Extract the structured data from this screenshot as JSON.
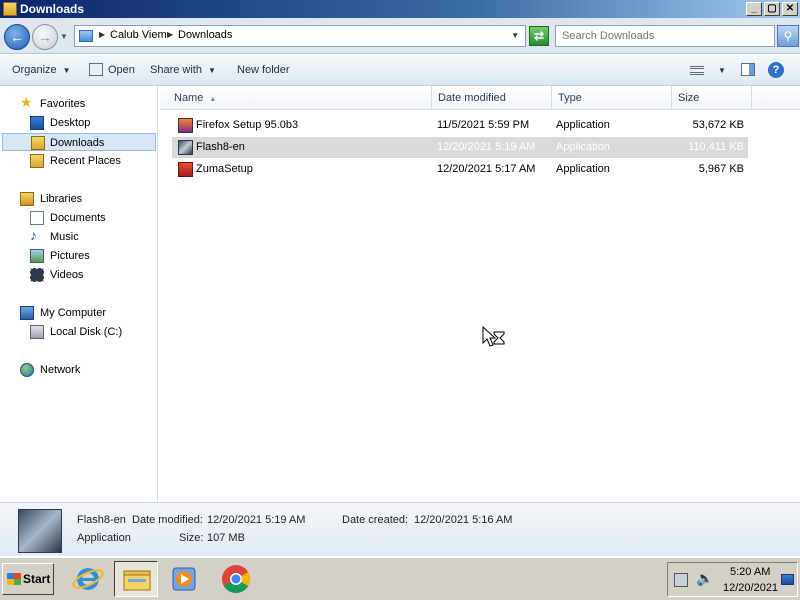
{
  "window": {
    "title": "Downloads",
    "min": "_",
    "max": "▢",
    "close": "✕"
  },
  "address": {
    "crumbs": [
      "Calub Viem",
      "Downloads"
    ],
    "search_placeholder": "Search Downloads"
  },
  "toolbar": {
    "organize": "Organize",
    "open": "Open",
    "share_with": "Share with",
    "new_folder": "New folder"
  },
  "nav": {
    "favorites": "Favorites",
    "desktop": "Desktop",
    "downloads": "Downloads",
    "recent_places": "Recent Places",
    "libraries": "Libraries",
    "documents": "Documents",
    "music": "Music",
    "pictures": "Pictures",
    "videos": "Videos",
    "my_computer": "My Computer",
    "local_disk": "Local Disk (C:)",
    "network": "Network"
  },
  "columns": {
    "name": "Name",
    "date_modified": "Date modified",
    "type": "Type",
    "size": "Size"
  },
  "files": [
    {
      "name": "Firefox Setup 95.0b3",
      "date": "11/5/2021 5:59 PM",
      "type": "Application",
      "size": "53,672 KB",
      "icon": "firefox-installer-icon"
    },
    {
      "name": "Flash8-en",
      "date": "12/20/2021 5:19 AM",
      "type": "Application",
      "size": "110,411 KB",
      "icon": "flash-installer-icon",
      "selected": true
    },
    {
      "name": "ZumaSetup",
      "date": "12/20/2021 5:17 AM",
      "type": "Application",
      "size": "5,967 KB",
      "icon": "zuma-installer-icon"
    }
  ],
  "details": {
    "name": "Flash8-en",
    "date_modified_label": "Date modified:",
    "date_modified": "12/20/2021 5:19 AM",
    "date_created_label": "Date created:",
    "date_created": "12/20/2021 5:16 AM",
    "type": "Application",
    "size_label": "Size:",
    "size": "107 MB"
  },
  "taskbar": {
    "start": "Start",
    "time": "5:20 AM",
    "date": "12/20/2021"
  }
}
